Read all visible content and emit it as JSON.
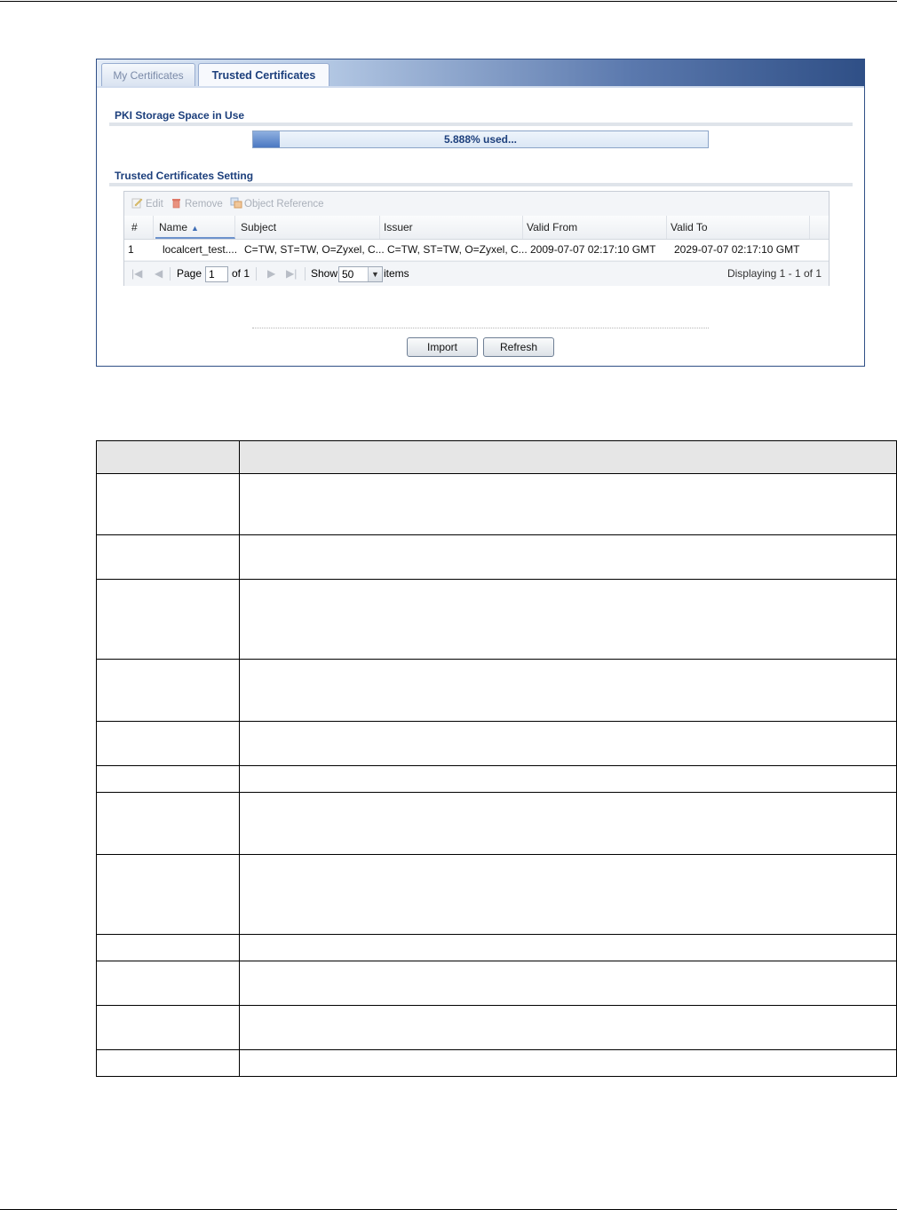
{
  "tabs": [
    {
      "label": "My Certificates",
      "active": false
    },
    {
      "label": "Trusted Certificates",
      "active": true
    }
  ],
  "storage": {
    "title": "PKI Storage Space in Use",
    "used_percent": 5.888,
    "used_label": "5.888% used..."
  },
  "trusted": {
    "title": "Trusted Certificates Setting",
    "toolbar": {
      "edit_label": "Edit",
      "remove_label": "Remove",
      "object_reference_label": "Object Reference"
    },
    "columns": [
      "#",
      "Name",
      "Subject",
      "Issuer",
      "Valid From",
      "Valid To"
    ],
    "rows": [
      {
        "index": "1",
        "name": "localcert_test....",
        "subject": "C=TW, ST=TW, O=Zyxel, C...",
        "issuer": "C=TW, ST=TW, O=Zyxel, C...",
        "valid_from": "2009-07-07 02:17:10 GMT",
        "valid_to": "2029-07-07 02:17:10 GMT"
      }
    ],
    "pager": {
      "page_label": "Page",
      "page_value": "1",
      "of_label": "of 1",
      "show_label": "Show",
      "show_value": "50",
      "items_label": "items",
      "displaying_label": "Displaying 1 - 1 of 1"
    }
  },
  "buttons": {
    "import_label": "Import",
    "refresh_label": "Refresh"
  },
  "colors": {
    "accent": "#1c3f7c",
    "frame": "#2f4f86",
    "progress_fill": "#4b78c2"
  }
}
